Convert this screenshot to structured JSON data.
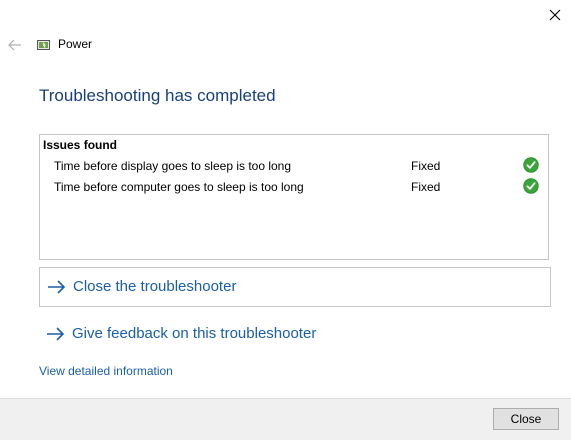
{
  "window": {
    "title": "Power"
  },
  "heading": "Troubleshooting has completed",
  "issues": {
    "title": "Issues found",
    "rows": [
      {
        "text": "Time before display goes to sleep is too long",
        "status": "Fixed",
        "icon": "check-circle-icon"
      },
      {
        "text": "Time before computer goes to sleep is too long",
        "status": "Fixed",
        "icon": "check-circle-icon"
      }
    ]
  },
  "links": {
    "close_troubleshooter": "Close the troubleshooter",
    "give_feedback": "Give feedback on this troubleshooter",
    "view_details": "View detailed information"
  },
  "footer": {
    "close_label": "Close"
  },
  "colors": {
    "heading": "#1a3f7a",
    "link": "#1a5fa8",
    "check": "#3aa53a",
    "footer_bg": "#f0f0f0"
  }
}
